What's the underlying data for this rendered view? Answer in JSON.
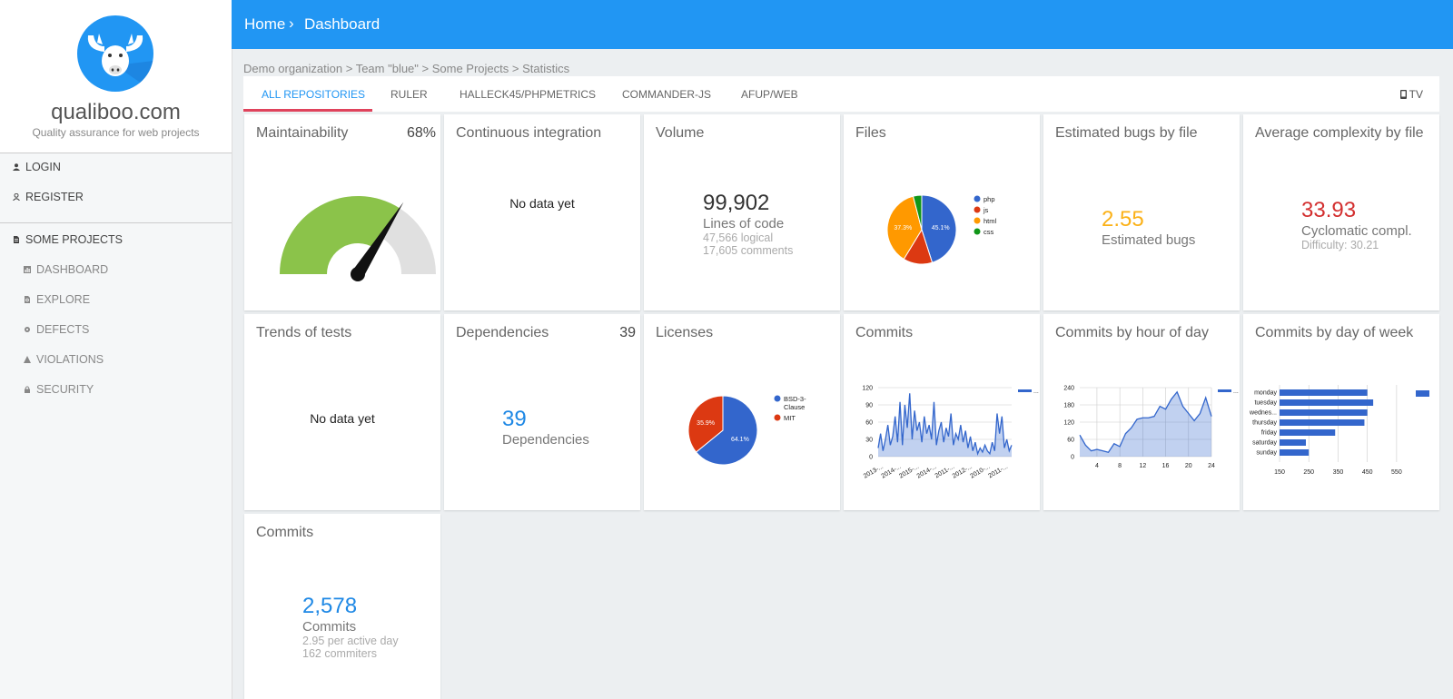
{
  "brand": {
    "name": "qualiboo.com",
    "tagline": "Quality assurance for web projects"
  },
  "sidebar": {
    "auth": [
      {
        "label": "LOGIN",
        "icon": "person-icon"
      },
      {
        "label": "REGISTER",
        "icon": "person-add-icon"
      }
    ],
    "project": {
      "label": "SOME PROJECTS",
      "icon": "document-icon"
    },
    "items": [
      {
        "label": "DASHBOARD",
        "icon": "dashboard-icon"
      },
      {
        "label": "EXPLORE",
        "icon": "search-doc-icon"
      },
      {
        "label": "DEFECTS",
        "icon": "bug-icon"
      },
      {
        "label": "VIOLATIONS",
        "icon": "warning-icon"
      },
      {
        "label": "SECURITY",
        "icon": "lock-icon"
      }
    ]
  },
  "header": {
    "home": "Home",
    "separator": "›",
    "current": "Dashboard"
  },
  "path": "Demo organization > Team \"blue\" > Some Projects > Statistics",
  "tabs": [
    {
      "label": "ALL REPOSITORIES",
      "active": true
    },
    {
      "label": "RULER"
    },
    {
      "label": "HALLECK45/PHPMETRICS"
    },
    {
      "label": "COMMANDER-JS"
    },
    {
      "label": "AFUP/WEB"
    }
  ],
  "tv_label": "TV",
  "colors": {
    "accent": "#2196f3",
    "tab_underline": "#e0435c",
    "green": "#8bc34a",
    "orange": "#fbb117",
    "red": "#d32f2f",
    "blue_text": "#1e88e5"
  },
  "cards": {
    "maintainability": {
      "title": "Maintainability",
      "badge": "68%",
      "value": 0.68
    },
    "ci": {
      "title": "Continuous integration",
      "text": "No data yet"
    },
    "volume": {
      "title": "Volume",
      "value": "99,902",
      "label": "Lines of code",
      "line1": "47,566 logical",
      "line2": "17,605 comments"
    },
    "files": {
      "title": "Files"
    },
    "bugs": {
      "title": "Estimated bugs by file",
      "value": "2.55",
      "label": "Estimated bugs"
    },
    "complexity": {
      "title": "Average complexity by file",
      "value": "33.93",
      "label": "Cyclomatic compl.",
      "line1": "Difficulty: 30.21"
    },
    "tests": {
      "title": "Trends of tests",
      "text": "No data yet"
    },
    "deps": {
      "title": "Dependencies",
      "badge": "39",
      "value": "39",
      "label": "Dependencies"
    },
    "licenses": {
      "title": "Licenses"
    },
    "commits_chart": {
      "title": "Commits"
    },
    "hour": {
      "title": "Commits by hour of day"
    },
    "week": {
      "title": "Commits by day of week"
    },
    "commits": {
      "title": "Commits",
      "value": "2,578",
      "label": "Commits",
      "line1": "2.95 per active day",
      "line2": "162 commiters"
    }
  },
  "chart_data": [
    {
      "type": "pie",
      "id": "files",
      "labels": [
        "php",
        "js",
        "html",
        "css"
      ],
      "values": [
        45.1,
        13.6,
        37.3,
        4.0
      ],
      "slice_labels": [
        "45.1%",
        "",
        "37.3%",
        ""
      ],
      "colors": [
        "#3366cc",
        "#dc3912",
        "#ff9900",
        "#109618"
      ],
      "legend": "right"
    },
    {
      "type": "pie",
      "id": "licenses",
      "labels": [
        "BSD-3-Clause",
        "MIT"
      ],
      "legend_lines": [
        [
          "BSD-3-",
          "Clause"
        ],
        [
          "MIT"
        ]
      ],
      "values": [
        64.1,
        35.9
      ],
      "slice_labels": [
        "64.1%",
        "35.9%"
      ],
      "colors": [
        "#3366cc",
        "#dc3912"
      ],
      "legend": "right"
    },
    {
      "type": "area",
      "id": "commits_chart",
      "ylim": [
        0,
        120
      ],
      "yticks": [
        "0",
        "30",
        "60",
        "90",
        "120"
      ],
      "xticks": [
        "2013-...",
        "2014-...",
        "2015-...",
        "2014-...",
        "2011-...",
        "2012-...",
        "2010-...",
        "2011-..."
      ],
      "values": [
        15,
        40,
        10,
        30,
        55,
        20,
        35,
        70,
        25,
        95,
        20,
        90,
        50,
        110,
        30,
        80,
        45,
        60,
        25,
        70,
        40,
        55,
        30,
        95,
        20,
        45,
        60,
        25,
        50,
        35,
        75,
        20,
        40,
        30,
        55,
        25,
        45,
        15,
        35,
        10,
        25,
        5,
        15,
        8,
        20,
        10,
        5,
        25,
        10,
        75,
        40,
        70,
        15,
        30,
        10,
        20
      ]
    },
    {
      "type": "area",
      "id": "hour",
      "ylim": [
        0,
        240
      ],
      "yticks": [
        "0",
        "60",
        "120",
        "180",
        "240"
      ],
      "xticks": [
        "4",
        "8",
        "12",
        "16",
        "20",
        "24"
      ],
      "x": [
        1,
        2,
        3,
        4,
        5,
        6,
        7,
        8,
        9,
        10,
        11,
        12,
        13,
        14,
        15,
        16,
        17,
        18,
        19,
        20,
        21,
        22,
        23,
        24
      ],
      "values": [
        75,
        40,
        20,
        25,
        20,
        15,
        45,
        35,
        80,
        100,
        130,
        135,
        135,
        140,
        175,
        165,
        200,
        225,
        175,
        150,
        125,
        150,
        205,
        140
      ]
    },
    {
      "type": "bar",
      "id": "week",
      "orientation": "horizontal",
      "categories": [
        "monday",
        "tuesday",
        "wednes...",
        "thursday",
        "friday",
        "saturday",
        "sunday"
      ],
      "values": [
        450,
        470,
        450,
        440,
        340,
        240,
        250
      ],
      "xlim": [
        150,
        600
      ],
      "xticks": [
        "150",
        "250",
        "350",
        "450",
        "550"
      ]
    }
  ]
}
